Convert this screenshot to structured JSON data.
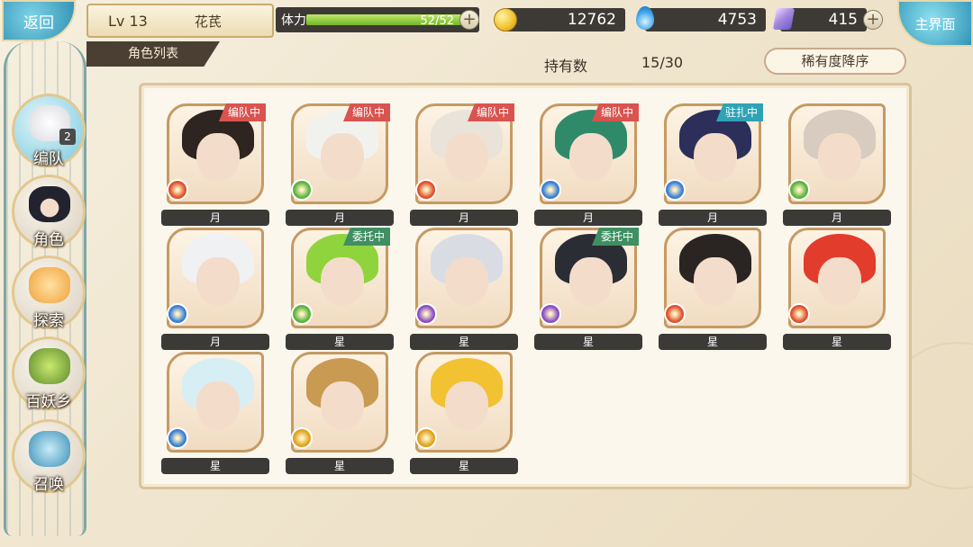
{
  "header": {
    "back_label": "返回",
    "level": "Lv 13",
    "player_name": "花芪",
    "stamina_label": "体力",
    "stamina_value": "52/52",
    "stamina_fraction": 1.0,
    "gold": "12762",
    "blue_currency": "4753",
    "crystal": "415",
    "main_label": "主界面"
  },
  "section_tab": "角色列表",
  "holdings": {
    "label": "持有数",
    "count": "15/30"
  },
  "sort_label": "稀有度降序",
  "nav": [
    {
      "label": "编队",
      "badge": "2",
      "icon": "formation-icon",
      "active": true
    },
    {
      "label": "角色",
      "icon": "character-icon"
    },
    {
      "label": "探索",
      "icon": "explore-icon"
    },
    {
      "label": "百妖乡",
      "icon": "village-icon"
    },
    {
      "label": "召唤",
      "icon": "summon-icon"
    }
  ],
  "characters": [
    {
      "rank": "月",
      "status": "编队中",
      "element": "fire",
      "hair": "#2f2520"
    },
    {
      "rank": "月",
      "status": "编队中",
      "element": "wind",
      "hair": "#f1f2ee"
    },
    {
      "rank": "月",
      "status": "编队中",
      "element": "fire",
      "hair": "#e9e3da"
    },
    {
      "rank": "月",
      "status": "编队中",
      "element": "water",
      "hair": "#2f8a6a"
    },
    {
      "rank": "月",
      "status": "驻扎中",
      "element": "water",
      "hair": "#2b2f5a"
    },
    {
      "rank": "月",
      "status": "",
      "element": "wind",
      "hair": "#d8cbbf"
    },
    {
      "rank": "月",
      "status": "",
      "element": "water",
      "hair": "#f0f1f3"
    },
    {
      "rank": "星",
      "status": "委托中",
      "element": "wind",
      "hair": "#8fd43c"
    },
    {
      "rank": "星",
      "status": "",
      "element": "dark",
      "hair": "#d9dde3"
    },
    {
      "rank": "星",
      "status": "委托中",
      "element": "dark",
      "hair": "#2b2d35"
    },
    {
      "rank": "星",
      "status": "",
      "element": "fire",
      "hair": "#2a2422"
    },
    {
      "rank": "星",
      "status": "",
      "element": "fire",
      "hair": "#e23c2c"
    },
    {
      "rank": "星",
      "status": "",
      "element": "water",
      "hair": "#d7eef5"
    },
    {
      "rank": "星",
      "status": "",
      "element": "light",
      "hair": "#c89a52"
    },
    {
      "rank": "星",
      "status": "",
      "element": "light",
      "hair": "#f2c233"
    }
  ],
  "colors": {
    "status_formation": "#d9534f",
    "status_station": "#2fa3b6",
    "status_delegate": "#3f8f62",
    "fire": "#e0502d",
    "wind": "#5cb33e",
    "water": "#3a7fd6",
    "dark": "#8a4fc3",
    "light": "#e1a21e"
  }
}
